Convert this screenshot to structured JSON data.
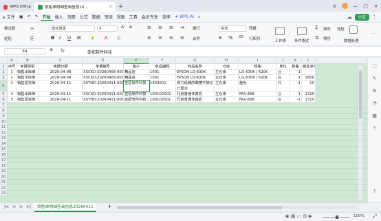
{
  "titlebar": {
    "app_tab": "WPS Office",
    "doc_tab": "销售单明细查询信息20…",
    "close_symbol": "×",
    "new_tab_symbol": "+",
    "menu_symbol": "≡",
    "minimize_symbol": "—",
    "maximize_symbol": "□"
  },
  "menu": {
    "file": "≡ 文件",
    "items": [
      "开始",
      "插入",
      "页面",
      "公式",
      "数据",
      "审阅",
      "视图",
      "工具",
      "会员专享",
      "效率"
    ],
    "active": "开始",
    "wps_ai": "✦ WPS AI",
    "share": "分享"
  },
  "ribbon": {
    "format_painter": "格式刷",
    "paste": "粘贴",
    "font_name": "微软雅黑",
    "font_size": "9",
    "wrap": "换行",
    "number_format": "常规",
    "convert": "转换",
    "merge": "合并",
    "rows_cols": "行和列",
    "worksheet": "工作表",
    "cond_format": "条件格式",
    "fill": "填充",
    "sort": "排序",
    "freeze": "冻结",
    "data_process": "数据处理",
    "more": "…"
  },
  "formula_bar": {
    "cell_ref": "E4",
    "fx": "fx",
    "value": "亚拓软件科技"
  },
  "columns": [
    "A",
    "B",
    "C",
    "D",
    "E",
    "F",
    "G",
    "H",
    "I",
    "J",
    "K",
    "L"
  ],
  "active_column": "E",
  "headers": [
    "序号",
    "单据类别",
    "单据日期",
    "单据编号",
    "客户",
    "商品编码",
    "商品名称",
    "仓库",
    "规格",
    "单位",
    "数量",
    "销售单价"
  ],
  "rows": [
    [
      "1",
      "销售出库单",
      "2026-04-08",
      "XSCKD-20260408-0005",
      "精品店",
      "1001",
      "EPSON LQ-630K",
      "主仓库",
      "LQ-630K | 620K",
      "台",
      "1",
      ""
    ],
    [
      "2",
      "销售出库单",
      "2026-04-08",
      "XSCKD-20260408-0005",
      "精品店",
      "1001",
      "EPSON LQ-630K",
      "主仓库",
      "LQ-630K | 620K",
      "台",
      "1",
      "1800"
    ],
    [
      "3",
      "销售退货单",
      "2026-04-11",
      "XSTHD-20260411-0006",
      "亚拓软件科技",
      "1003001",
      "得力经典防霉擦不掉记账本",
      "主仓库",
      "蓝色",
      "只",
      "-1",
      "10"
    ],
    [
      "4",
      "销售出库单",
      "2026-04-11",
      "XSCKD-20260411-0006",
      "亚拓软件科技",
      "100102002",
      "兄弟普通传真机",
      "主仓库",
      "FAX-888",
      "台",
      "1",
      "1320"
    ],
    [
      "5",
      "销售退货单",
      "2026-04-11",
      "XSTHD-20260411-0008",
      "亚拓软件科技",
      "100102002",
      "兄弟普通传真机",
      "主仓库",
      "FAX-888",
      "台",
      "-1",
      "1320"
    ]
  ],
  "row3_g_line2": "计算本",
  "row_numbers": [
    "1",
    "2",
    "3",
    "4",
    "5",
    "6",
    "7",
    "8",
    "9",
    "10",
    "11",
    "12",
    "13",
    "14",
    "15",
    "16",
    "17",
    "18",
    "19",
    "20",
    "21",
    "22",
    "23"
  ],
  "active_row": "4",
  "sheet": {
    "name": "销售单明细查询信息20260411",
    "add": "+"
  },
  "status": {
    "zoom": "100%"
  },
  "colors": {
    "accent": "#1f7a3c",
    "grid_bg": "#cfe8d2"
  }
}
